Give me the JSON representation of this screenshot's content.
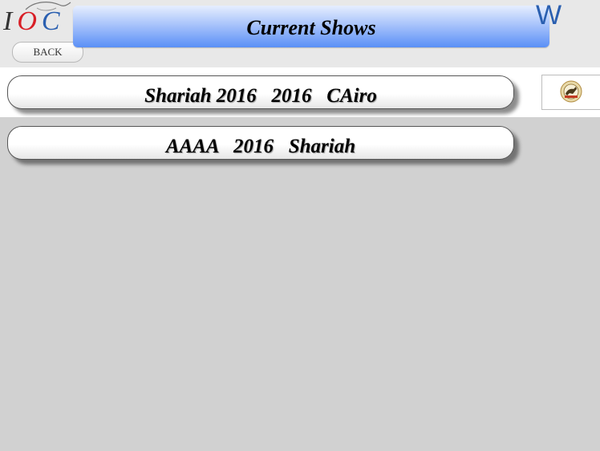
{
  "header": {
    "logo_text": "IOC",
    "back_label": "BACK",
    "title": "Current Shows",
    "w_letter": "W"
  },
  "shows": [
    {
      "label": "Shariah 2016   2016   CAiro"
    },
    {
      "label": "AAAA   2016   Shariah"
    }
  ],
  "colors": {
    "title_gradient_top": "#e6eefe",
    "title_gradient_bottom": "#5a8ff6",
    "accent_blue": "#2a5fb0",
    "logo_red": "#d81f26",
    "background": "#d1d1d1"
  },
  "icons": {
    "logo": "ioc-horse-logo",
    "badge": "show-jumping-horse-icon"
  }
}
